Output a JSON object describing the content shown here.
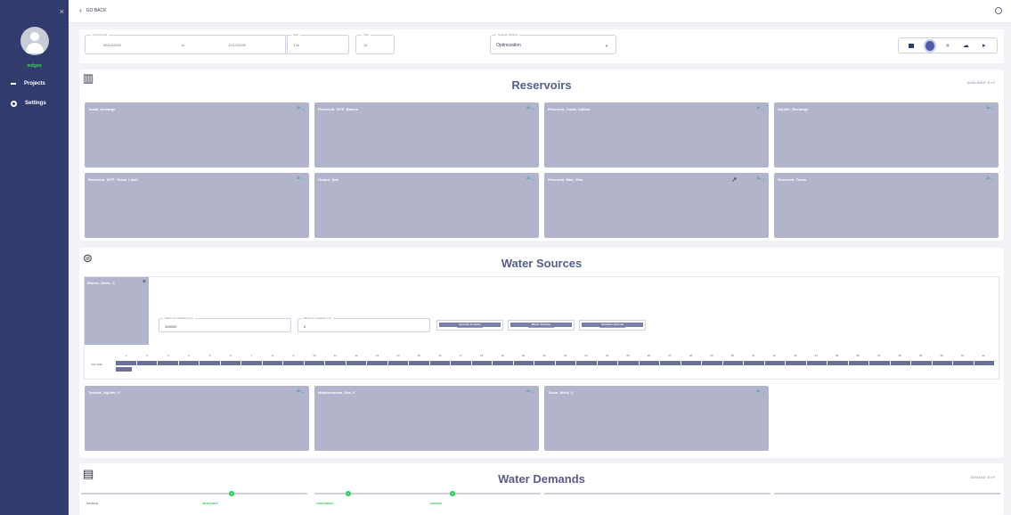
{
  "sidebar": {
    "close_glyph": "×",
    "username": "mdgen",
    "items": [
      {
        "label": "Projects",
        "icon": "dash-icon"
      },
      {
        "label": "Settings",
        "icon": "gear-icon"
      }
    ]
  },
  "topbar": {
    "back_label": "GO BACK"
  },
  "filters": {
    "date_label": "Time Period",
    "date_from": "08/10/2020",
    "date_to_sep": "to",
    "date_to": "12/17/2020",
    "step_label": "Step",
    "step_value": "1 hr",
    "year_label": "Year",
    "year_value": "10",
    "method_label": "Network Method",
    "method_value": "Optimization"
  },
  "reservoirs": {
    "title": "Reservoirs",
    "available": "AVAILABLE: 8 m³",
    "cards": [
      "Tossa_recharge",
      "Reservoir_WTP_Blanes",
      "Reservoir_Costa_Calfina",
      "Aquifer_Recharge",
      "Reservoir_WTP_Tossa_Llavit",
      "Output_Sea",
      "Reservoir_Mas_Villa",
      "Reservoir_Tossa"
    ]
  },
  "water_sources": {
    "title": "Water Sources",
    "open_source": "Blanes_Wells_C",
    "max_label": "Maximum Capacity (m³)",
    "max_value": "100000",
    "min_label": "Minimum Capacity (m³)",
    "min_value": "0",
    "tags": [
      "Summer Scheme",
      "Winter Scheme",
      "Shoulder Scheme"
    ],
    "grid_label": "VOLUME",
    "grid_numbers": [
      "1",
      "2",
      "3",
      "4",
      "5",
      "6",
      "7",
      "8",
      "9",
      "10",
      "11",
      "12",
      "13",
      "14",
      "15",
      "16",
      "17",
      "18",
      "19",
      "20",
      "21",
      "22",
      "23",
      "24",
      "25",
      "26",
      "27",
      "28",
      "29",
      "30",
      "31",
      "32",
      "33",
      "34",
      "35",
      "36",
      "37",
      "38",
      "39",
      "40",
      "41",
      "42"
    ],
    "cards": [
      "Tordera_Aquifer_C",
      "Mediterranean_Sea_C",
      "Tossa_Wells_C"
    ]
  },
  "water_demands": {
    "title": "Water Demands",
    "demand": "DEMAND: 8 m³",
    "columns": [
      {
        "label": "SOURCE",
        "green": "INFEASIBLE",
        "badge": "0"
      },
      {
        "label": "",
        "green": "UNBOUNDED",
        "badge": "0"
      },
      {
        "label": "",
        "green": "ERRORS",
        "badge": "0"
      },
      {
        "label": "",
        "green": "",
        "badge": ""
      }
    ]
  }
}
